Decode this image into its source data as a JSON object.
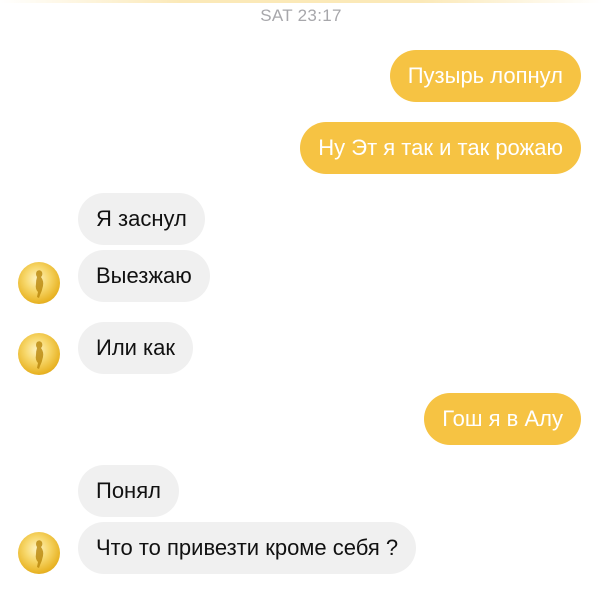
{
  "chat": {
    "timestamp": "SAT 23:17",
    "messages": [
      {
        "text": "Пузырь лопнул",
        "direction": "outgoing"
      },
      {
        "text": "Ну Эт я так и так рожаю",
        "direction": "outgoing"
      },
      {
        "text": "Я заснул",
        "direction": "incoming"
      },
      {
        "text": "Выезжаю",
        "direction": "incoming"
      },
      {
        "text": "Или как",
        "direction": "incoming"
      },
      {
        "text": "Гош я в Алу",
        "direction": "outgoing"
      },
      {
        "text": "Понял",
        "direction": "incoming"
      },
      {
        "text": "Что то привезти кроме себя ?",
        "direction": "incoming"
      }
    ]
  },
  "colors": {
    "outgoing_bubble": "#f6c343",
    "incoming_bubble": "#f0f0f0",
    "timestamp": "#a7a7ab"
  },
  "icons": {
    "contact_avatar": "golden-figure-avatar-icon"
  }
}
